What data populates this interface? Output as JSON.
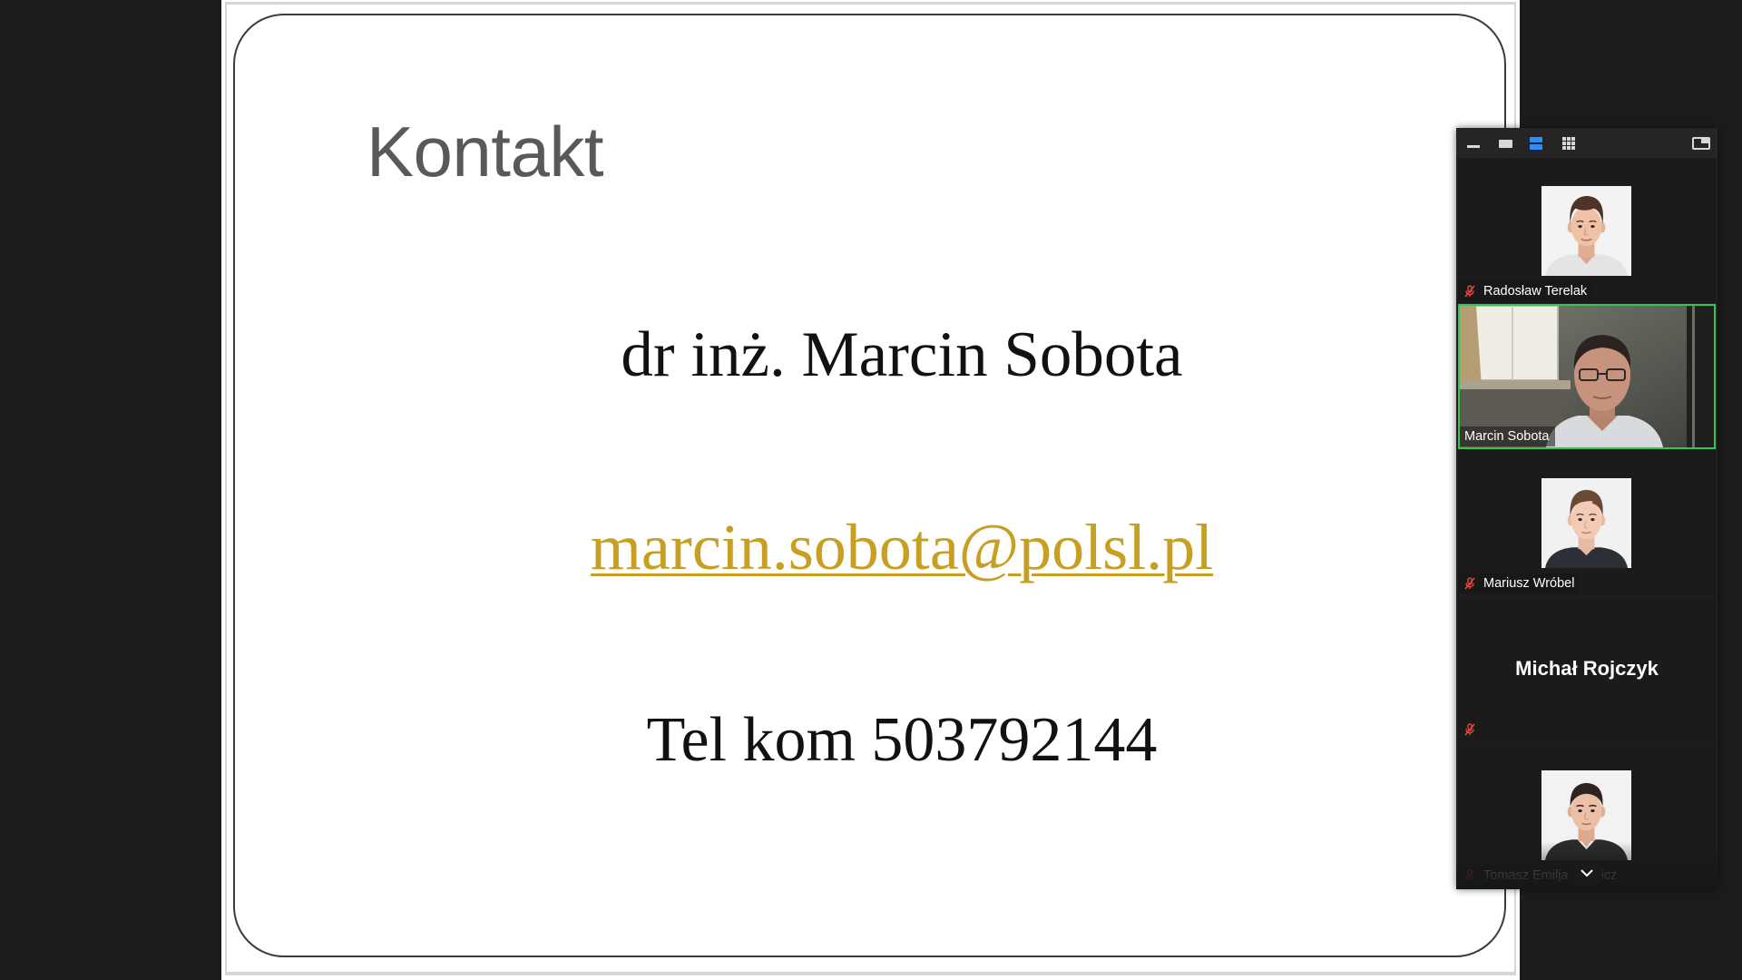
{
  "slide": {
    "title": "Kontakt",
    "name_line": "dr inż. Marcin Sobota",
    "email": "marcin.sobota@polsl.pl",
    "phone_line": "Tel kom 503792144",
    "colors": {
      "title": "#595959",
      "email": "#c7a023",
      "text": "#111111"
    }
  },
  "panel": {
    "toolbar": {
      "icons": [
        "minimize-icon",
        "speaker-view-icon",
        "gallery-strip-icon",
        "gallery-view-icon",
        "hide-panel-icon"
      ],
      "active_icon": "gallery-strip-icon",
      "active_color": "#2d8cff"
    },
    "participants": [
      {
        "name": "Radosław Terelak",
        "muted": true
      },
      {
        "name": "Marcin Sobota",
        "muted": false,
        "active_speaker": true
      },
      {
        "name": "Mariusz Wróbel",
        "muted": true
      },
      {
        "name": "Michał Rojczyk",
        "muted": true
      },
      {
        "name_visible_start": "Tomasz Emilja",
        "name_visible_end": "icz",
        "muted": true
      }
    ],
    "active_speaker_color": "#33c653",
    "muted_icon": "mic-muted-icon",
    "muted_icon_color": "#e5483f",
    "scroll_icon": "chevron-down-icon"
  }
}
